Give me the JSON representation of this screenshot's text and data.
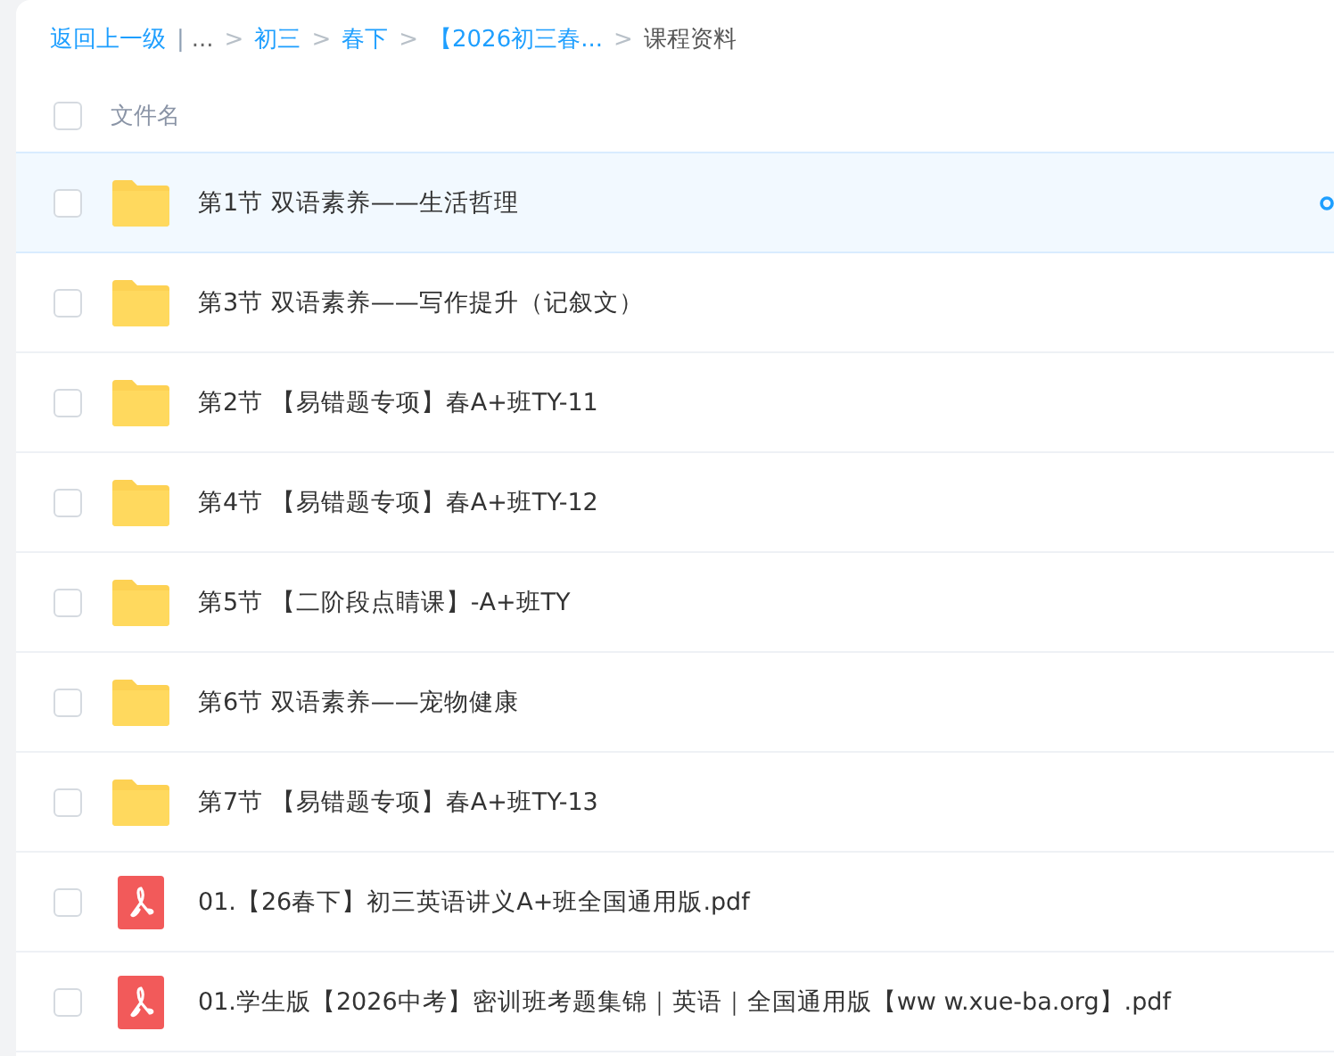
{
  "breadcrumb": [
    {
      "text": "返回上一级",
      "kind": "link"
    },
    {
      "text": "|",
      "kind": "divider"
    },
    {
      "text": "...",
      "kind": "ellipsis"
    },
    {
      "text": ">",
      "kind": "separator"
    },
    {
      "text": "初三",
      "kind": "link"
    },
    {
      "text": ">",
      "kind": "separator"
    },
    {
      "text": "春下",
      "kind": "link"
    },
    {
      "text": ">",
      "kind": "separator"
    },
    {
      "text": "【2026初三春...",
      "kind": "link"
    },
    {
      "text": ">",
      "kind": "separator"
    },
    {
      "text": "课程资料",
      "kind": "current"
    }
  ],
  "header": {
    "checked": false,
    "label": "文件名"
  },
  "files": [
    {
      "name": "第1节 双语素养——生活哲理",
      "kind": "folder",
      "checked": false,
      "highlighted": true
    },
    {
      "name": "第3节 双语素养——写作提升（记叙文）",
      "kind": "folder",
      "checked": false,
      "highlighted": false
    },
    {
      "name": "第2节 【易错题专项】春A+班TY-11",
      "kind": "folder",
      "checked": false,
      "highlighted": false
    },
    {
      "name": "第4节 【易错题专项】春A+班TY-12",
      "kind": "folder",
      "checked": false,
      "highlighted": false
    },
    {
      "name": "第5节 【二阶段点睛课】-A+班TY",
      "kind": "folder",
      "checked": false,
      "highlighted": false
    },
    {
      "name": "第6节 双语素养——宠物健康",
      "kind": "folder",
      "checked": false,
      "highlighted": false
    },
    {
      "name": "第7节 【易错题专项】春A+班TY-13",
      "kind": "folder",
      "checked": false,
      "highlighted": false
    },
    {
      "name": "01.【26春下】初三英语讲义A+班全国通用版.pdf",
      "kind": "pdf",
      "checked": false,
      "highlighted": false
    },
    {
      "name": "01.学生版【2026中考】密训班考题集锦｜英语｜全国通用版【ww w.xue-ba.org】.pdf",
      "kind": "pdf",
      "checked": false,
      "highlighted": false
    }
  ]
}
